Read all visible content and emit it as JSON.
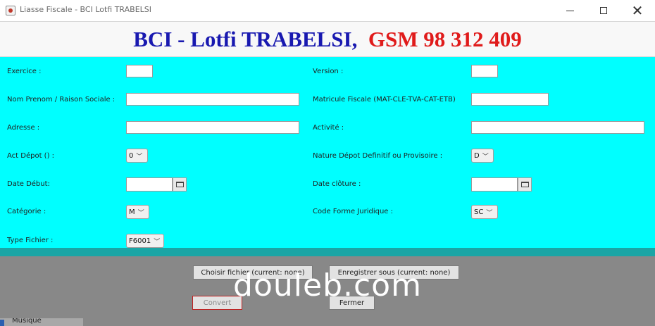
{
  "window": {
    "title": "Liasse Fiscale - BCI Lotfi TRABELSI",
    "minimize_icon": "minimize-icon",
    "maximize_icon": "maximize-icon",
    "close_glyph": "✕"
  },
  "header": {
    "part1": "BCI - Lotfi TRABELSI,",
    "part2": "GSM  98 312 409",
    "color1": "#1919b0",
    "color2": "#e01b1b"
  },
  "form": {
    "background": "#00ffff",
    "left": {
      "exercice_label": "Exercice :",
      "exercice_value": "",
      "nom_label": "Nom Prenom / Raison Sociale :",
      "nom_value": "",
      "adresse_label": "Adresse :",
      "adresse_value": "",
      "act_depot_label": "Act Dépot () :",
      "act_depot_value": "0",
      "date_debut_label": "Date Début:",
      "date_debut_value": "",
      "categorie_label": "Catégorie :",
      "categorie_value": "M",
      "type_fichier_label": "Type Fichier :",
      "type_fichier_value": "F6001"
    },
    "right": {
      "version_label": "Version :",
      "version_value": "",
      "matricule_label": "Matricule Fiscale (MAT-CLE-TVA-CAT-ETB)",
      "matricule_value": "",
      "activite_label": "Activité :",
      "activite_value": "",
      "nature_label": "Nature Dépot Definitif ou Provisoire :",
      "nature_value": "D",
      "date_cloture_label": "Date clôture :",
      "date_cloture_value": "",
      "code_forme_label": "Code Forme Juridique :",
      "code_forme_value": "SC"
    }
  },
  "actions": {
    "choose_file": "Choisir fichier (current: none)",
    "save_as": "Enregistrer sous (current: none)",
    "convert": "Convert",
    "close": "Fermer"
  },
  "watermark": "douleb.com",
  "taskbar": {
    "item": "Musique"
  }
}
